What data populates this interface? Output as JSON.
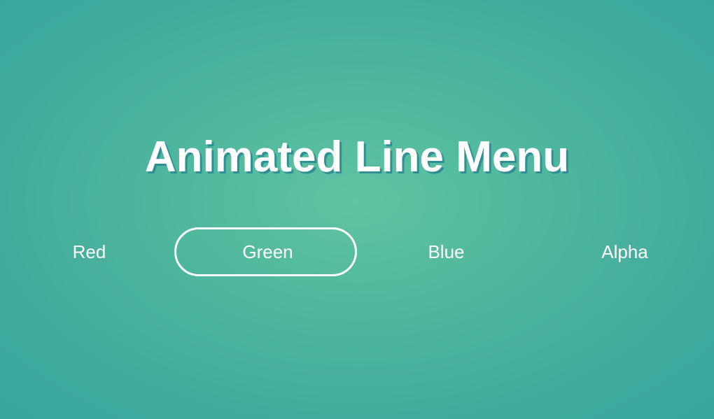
{
  "page": {
    "title": "Animated Line Menu"
  },
  "menu": {
    "items": [
      {
        "label": "Red",
        "active": false
      },
      {
        "label": "Green",
        "active": true
      },
      {
        "label": "Blue",
        "active": false
      },
      {
        "label": "Alpha",
        "active": false
      }
    ]
  },
  "colors": {
    "background_center": "#5fc3a2",
    "background_edge": "#39a69e",
    "text": "#ffffff",
    "title_shadow": "#2f8f95",
    "active_outline": "#ffffff"
  }
}
